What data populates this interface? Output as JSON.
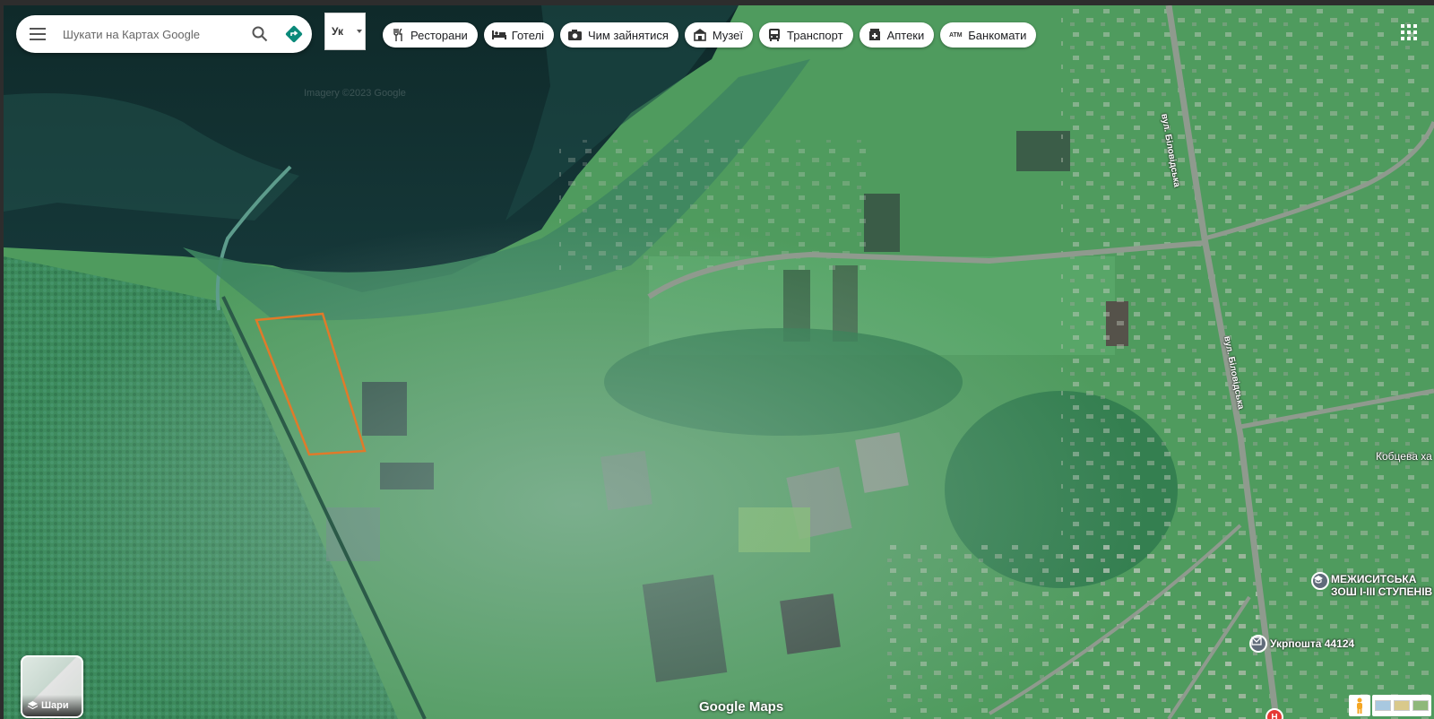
{
  "search": {
    "placeholder": "Шукати на Картах Google"
  },
  "language": {
    "selected": "Ук"
  },
  "chips": [
    {
      "label": "Ресторани",
      "icon": "fork-knife-icon"
    },
    {
      "label": "Готелі",
      "icon": "bed-icon"
    },
    {
      "label": "Чим зайнятися",
      "icon": "camera-icon"
    },
    {
      "label": "Музеї",
      "icon": "museum-icon"
    },
    {
      "label": "Транспорт",
      "icon": "bus-icon"
    },
    {
      "label": "Аптеки",
      "icon": "pharmacy-icon"
    },
    {
      "label": "Банкомати",
      "icon": "atm-icon"
    }
  ],
  "map": {
    "streets": [
      "вул. Біловідська",
      "вул. Біловідська"
    ],
    "places": [
      "Кобцева ха"
    ],
    "pois": [
      {
        "name": "МЕЖИСИТСЬКА ЗОШ І-ІІІ СТУПЕНІВ",
        "icon": "school-icon"
      },
      {
        "name": "Укрпошта 44124",
        "icon": "post-office-icon"
      }
    ],
    "hospital_marker": "H",
    "watermark": "Imagery ©2023 Google",
    "parcel_outline_color": "#e07a2a"
  },
  "layers": {
    "label": "Шари"
  },
  "attribution": {
    "logo": "Google Maps"
  }
}
